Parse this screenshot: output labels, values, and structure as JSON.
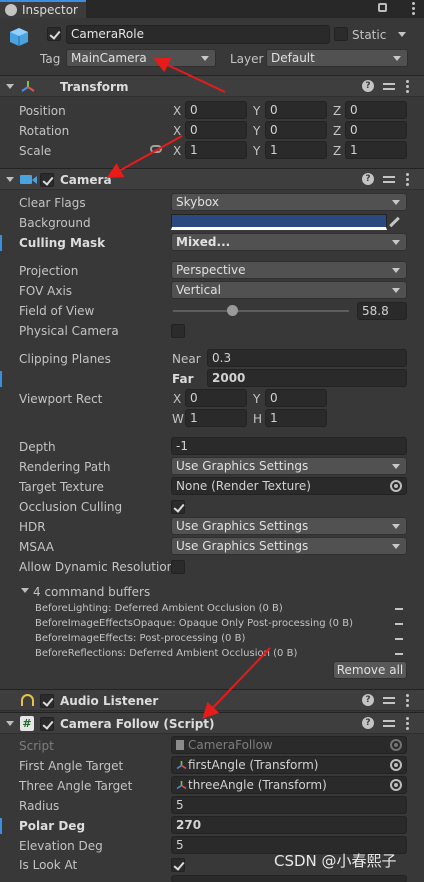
{
  "tab": {
    "title": "Inspector"
  },
  "object": {
    "name": "CameraRole",
    "static_label": "Static",
    "tag_label": "Tag",
    "tag_value": "MainCamera",
    "layer_label": "Layer",
    "layer_value": "Default"
  },
  "transform": {
    "title": "Transform",
    "rows": [
      {
        "label": "Position",
        "x": "0",
        "y": "0",
        "z": "0"
      },
      {
        "label": "Rotation",
        "x": "0",
        "y": "0",
        "z": "0"
      },
      {
        "label": "Scale",
        "x": "1",
        "y": "1",
        "z": "1"
      }
    ],
    "axes": {
      "x": "X",
      "y": "Y",
      "z": "Z"
    }
  },
  "camera": {
    "title": "Camera",
    "clear_flags": {
      "label": "Clear Flags",
      "value": "Skybox"
    },
    "background": {
      "label": "Background",
      "color": "#2a4a7f"
    },
    "culling_mask": {
      "label": "Culling Mask",
      "value": "Mixed..."
    },
    "projection": {
      "label": "Projection",
      "value": "Perspective"
    },
    "fov_axis": {
      "label": "FOV Axis",
      "value": "Vertical"
    },
    "field_of_view": {
      "label": "Field of View",
      "value": "58.8",
      "fraction": 0.33
    },
    "physical_camera": {
      "label": "Physical Camera"
    },
    "clipping": {
      "label": "Clipping Planes",
      "near_label": "Near",
      "near": "0.3",
      "far_label": "Far",
      "far": "2000"
    },
    "viewport": {
      "label": "Viewport Rect",
      "x_label": "X",
      "x": "0",
      "y_label": "Y",
      "y": "0",
      "w_label": "W",
      "w": "1",
      "h_label": "H",
      "h": "1"
    },
    "depth": {
      "label": "Depth",
      "value": "-1"
    },
    "rendering_path": {
      "label": "Rendering Path",
      "value": "Use Graphics Settings"
    },
    "target_texture": {
      "label": "Target Texture",
      "value": "None (Render Texture)"
    },
    "occlusion_culling": {
      "label": "Occlusion Culling"
    },
    "hdr": {
      "label": "HDR",
      "value": "Use Graphics Settings"
    },
    "msaa": {
      "label": "MSAA",
      "value": "Use Graphics Settings"
    },
    "dynamic_res": {
      "label": "Allow Dynamic Resolution"
    },
    "command_buffers": {
      "label": "4 command buffers",
      "items": [
        "BeforeLighting: Deferred Ambient Occlusion (0 B)",
        "BeforeImageEffectsOpaque: Opaque Only Post-processing (0 B)",
        "BeforeImageEffects: Post-processing (0 B)",
        "BeforeReflections: Deferred Ambient Occlusion (0 B)"
      ],
      "remove_all": "Remove all"
    }
  },
  "audio_listener": {
    "title": "Audio Listener"
  },
  "camera_follow": {
    "title": "Camera Follow (Script)",
    "script": {
      "label": "Script",
      "value": "CameraFollow"
    },
    "first_angle": {
      "label": "First Angle Target",
      "value": "firstAngle (Transform)"
    },
    "three_angle": {
      "label": "Three Angle Target",
      "value": "threeAngle (Transform)"
    },
    "radius": {
      "label": "Radius",
      "value": "5"
    },
    "polar_deg": {
      "label": "Polar Deg",
      "value": "270"
    },
    "elevation_deg": {
      "label": "Elevation Deg",
      "value": "5"
    },
    "is_look_at": {
      "label": "Is Look At"
    }
  },
  "watermark": "CSDN @小春熙子",
  "colors": {
    "background": "#383838",
    "header": "#3e3e3e",
    "field": "#2a2a2a",
    "dropdown": "#515151",
    "accent_blue": "#3b8fe0",
    "arrow_red": "#e81b1b"
  }
}
